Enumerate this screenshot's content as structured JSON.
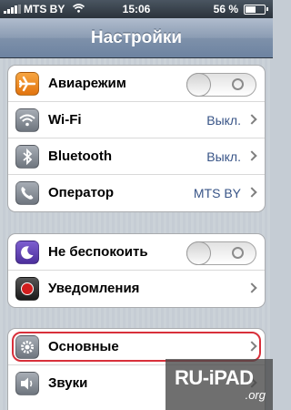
{
  "status_bar": {
    "carrier": "MTS BY",
    "time": "15:06",
    "battery_percent": "56 %",
    "battery_level": 0.56
  },
  "nav": {
    "title": "Настройки"
  },
  "groups": [
    {
      "rows": [
        {
          "label": "Авиарежим",
          "icon": "airplane-icon",
          "control": "toggle",
          "toggle_on": false
        },
        {
          "label": "Wi-Fi",
          "icon": "wifi-icon",
          "value": "Выкл."
        },
        {
          "label": "Bluetooth",
          "icon": "bluetooth-icon",
          "value": "Выкл."
        },
        {
          "label": "Оператор",
          "icon": "phone-icon",
          "value": "MTS BY"
        }
      ]
    },
    {
      "rows": [
        {
          "label": "Не беспокоить",
          "icon": "moon-icon",
          "control": "toggle",
          "toggle_on": false
        },
        {
          "label": "Уведомления",
          "icon": "notifications-icon"
        }
      ]
    },
    {
      "rows": [
        {
          "label": "Основные",
          "icon": "gear-icon",
          "highlighted": true
        },
        {
          "label": "Звуки",
          "icon": "speaker-icon"
        }
      ]
    }
  ],
  "watermark": {
    "text": "RU-iPAD",
    "sub": ".org"
  },
  "colors": {
    "nav_blue": "#6d83a1",
    "value_blue": "#385487",
    "highlight_red": "#d8303b",
    "airplane_orange": "#f08a1c",
    "notifications_red": "#d11e1e"
  }
}
